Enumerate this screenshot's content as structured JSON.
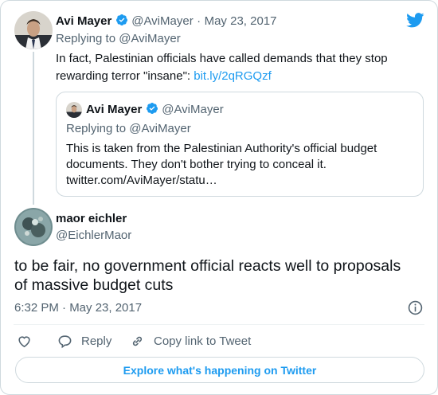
{
  "parent_tweet": {
    "author_name": "Avi Mayer",
    "handle": "@AviMayer",
    "separator": "·",
    "date": "May 23, 2017",
    "replying_prefix": "Replying to",
    "replying_to": "@AviMayer",
    "text": "In fact, Palestinian officials have called demands that they stop rewarding terror \"insane\": ",
    "link": "bit.ly/2qRGQzf"
  },
  "quoted_tweet": {
    "author_name": "Avi Mayer",
    "handle": "@AviMayer",
    "replying_prefix": "Replying to",
    "replying_to": "@AviMayer",
    "text_line1": "This is taken from the Palestinian Authority's official budget",
    "text_line2": "documents. They don't bother trying to conceal it.",
    "text_line3": "twitter.com/AviMayer/statu…"
  },
  "main_tweet": {
    "author_name": "maor eichler",
    "handle": "@EichlerMaor",
    "text_line1": "to be fair, no government official reacts well to proposals",
    "text_line2": "of massive budget cuts",
    "timestamp": "6:32 PM · May 23, 2017"
  },
  "actions": {
    "reply_label": "Reply",
    "copy_link_label": "Copy link to Tweet"
  },
  "explore_label": "Explore what's happening on Twitter",
  "colors": {
    "accent": "#1d9bf0",
    "text": "#0f1419",
    "muted": "#536471",
    "border": "#cfd9de"
  },
  "icons": [
    "twitter-bird-icon",
    "verified-badge-icon",
    "info-icon",
    "heart-icon",
    "reply-bubble-icon",
    "link-chain-icon"
  ]
}
